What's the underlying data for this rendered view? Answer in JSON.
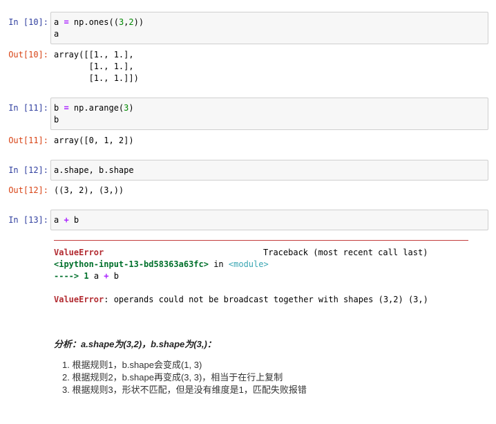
{
  "cells": [
    {
      "in_prompt": "In  [10]:",
      "code_lines": [
        "a = np.ones((3,2))",
        "a"
      ],
      "out_prompt": "Out[10]:",
      "output_lines": [
        "array([[1., 1.],",
        "       [1., 1.],",
        "       [1., 1.]])"
      ]
    },
    {
      "in_prompt": "In  [11]:",
      "code_lines": [
        "b = np.arange(3)",
        "b"
      ],
      "out_prompt": "Out[11]:",
      "output_lines": [
        "array([0, 1, 2])"
      ]
    },
    {
      "in_prompt": "In  [12]:",
      "code_lines": [
        "a.shape, b.shape"
      ],
      "out_prompt": "Out[12]:",
      "output_lines": [
        "((3, 2), (3,))"
      ]
    },
    {
      "in_prompt": "In  [13]:",
      "code_lines": [
        "a + b"
      ]
    }
  ],
  "traceback": {
    "error_name": "ValueError",
    "header_right": "Traceback (most recent call last)",
    "source": "<ipython-input-13-bd58363a63fc>",
    "in_word": "in",
    "module": "<module>",
    "arrow": "---->",
    "line_no": "1",
    "line_code": "a + b",
    "final_error_name": "ValueError",
    "final_message": ": operands could not be broadcast together with shapes (3,2) (3,)"
  },
  "analysis": {
    "title": "分析：a.shape为(3,2)，b.shape为(3,)：",
    "items": [
      "1. 根据规则1，b.shape会变成(1, 3)",
      "2. 根据规则2，b.shape再变成(3, 3)，相当于在行上复制",
      "3. 根据规则3，形状不匹配，但是没有维度是1，匹配失败报错"
    ]
  }
}
